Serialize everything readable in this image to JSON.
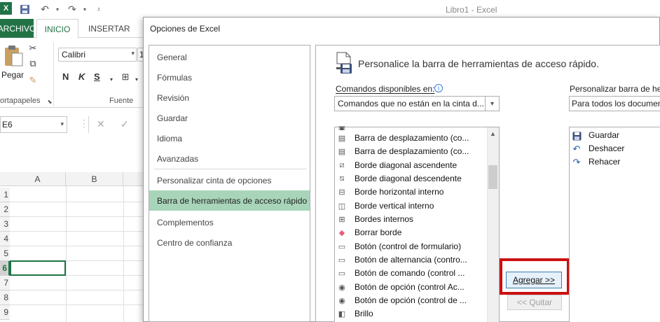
{
  "excel": {
    "app_title": "Libro1 - Excel",
    "tabs": {
      "file": "ARCHIVO",
      "home": "INICIO",
      "insert": "INSERTAR"
    },
    "clipboard": {
      "paste_label": "Pegar",
      "group_label": "ortapapeles"
    },
    "font": {
      "name": "Calibri",
      "size": "1",
      "bold": "N",
      "italic": "K",
      "underline": "S",
      "group_label": "Fuente"
    },
    "name_box": "E6",
    "columns": [
      "A",
      "B"
    ],
    "rows": [
      "1",
      "2",
      "3",
      "4",
      "5",
      "6",
      "7",
      "8",
      "9"
    ],
    "selected_row": "6"
  },
  "dialog": {
    "title": "Opciones de Excel",
    "nav": [
      "General",
      "Fórmulas",
      "Revisión",
      "Guardar",
      "Idioma",
      "Avanzadas",
      "Personalizar cinta de opciones",
      "Barra de herramientas de acceso rápido",
      "Complementos",
      "Centro de confianza"
    ],
    "selected_nav": "Barra de herramientas de acceso rápido",
    "heading": "Personalice la barra de herramientas de acceso rápido.",
    "commands_label": "Comandos disponibles en:",
    "commands_select": "Comandos que no están en la cinta d...",
    "commands": [
      {
        "icon": "scroll-icon",
        "label": "Barra de desplazamiento (co..."
      },
      {
        "icon": "scroll-icon",
        "label": "Barra de desplazamiento (co..."
      },
      {
        "icon": "border-diag-up-icon",
        "label": "Borde diagonal ascendente"
      },
      {
        "icon": "border-diag-down-icon",
        "label": "Borde diagonal descendente"
      },
      {
        "icon": "border-h-icon",
        "label": "Borde horizontal interno"
      },
      {
        "icon": "border-v-icon",
        "label": "Borde vertical interno"
      },
      {
        "icon": "border-inner-icon",
        "label": "Bordes internos"
      },
      {
        "icon": "eraser-icon",
        "label": "Borrar borde"
      },
      {
        "icon": "button-form-icon",
        "label": "Botón (control de formulario)"
      },
      {
        "icon": "toggle-icon",
        "label": "Botón de alternancia (contro..."
      },
      {
        "icon": "command-button-icon",
        "label": "Botón de comando (control ..."
      },
      {
        "icon": "radio-icon",
        "label": "Botón de opción (control Ac..."
      },
      {
        "icon": "radio-icon",
        "label": "Botón de opción (control de ..."
      },
      {
        "icon": "brightness-icon",
        "label": "Brillo"
      }
    ],
    "add_button": "Agregar >>",
    "remove_button": "<< Quitar",
    "customize_label": "Personalizar barra de her",
    "customize_select": "Para todos los documen",
    "qat_items": [
      {
        "icon": "save-icon",
        "label": "Guardar"
      },
      {
        "icon": "undo-icon",
        "label": "Deshacer"
      },
      {
        "icon": "redo-icon",
        "label": "Rehacer"
      }
    ],
    "colors": {
      "excel_green": "#217346",
      "nav_selected": "#a8d5b9",
      "highlight_red": "#cc1010",
      "link_blue": "#1e5aa8"
    }
  }
}
